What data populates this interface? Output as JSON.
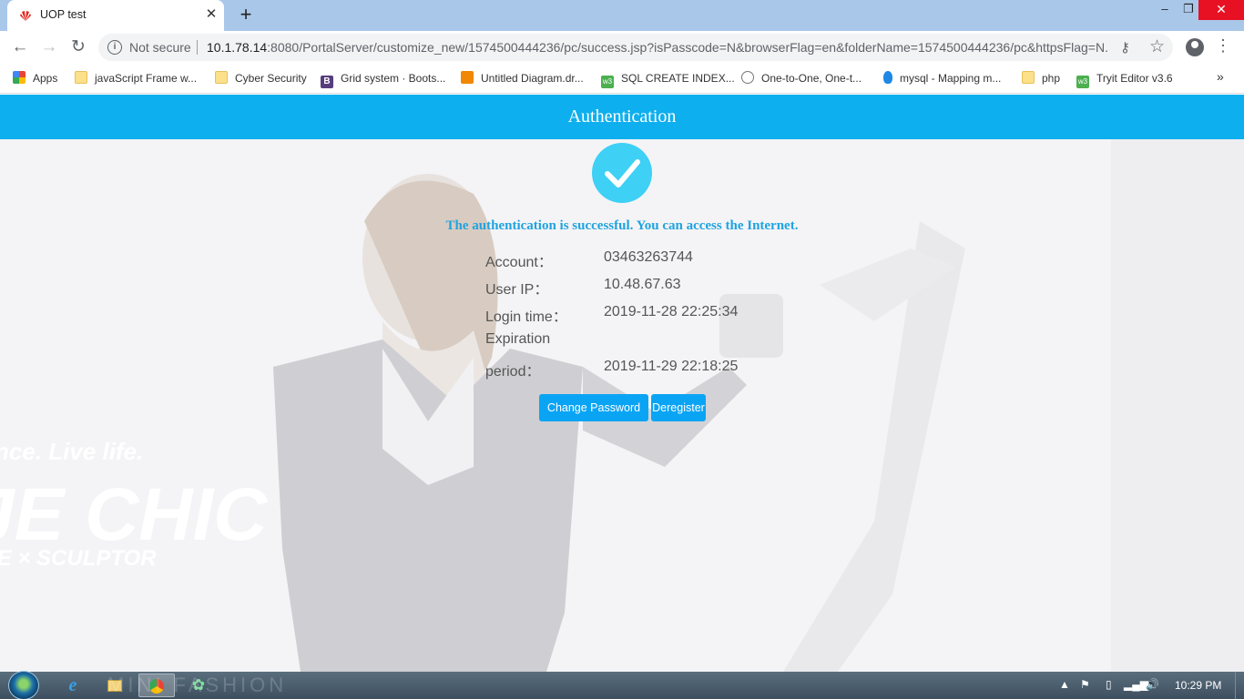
{
  "browser": {
    "tab": {
      "title": "UOP test"
    },
    "new_tab_label": "+",
    "window_controls": {
      "minimize": "–",
      "maximize": "❐",
      "close": "✕"
    },
    "toolbar": {
      "back": "←",
      "forward": "→",
      "reload": "↻",
      "security_label": "Not secure",
      "url_host": "10.1.78.14",
      "url_rest": ":8080/PortalServer/customize_new/1574500444236/pc/success.jsp?isPasscode=N&browserFlag=en&folderName=1574500444236/pc&httpsFlag=N..."
    },
    "bookmarks": [
      {
        "label": "Apps",
        "icon": "apps-grid-icon"
      },
      {
        "label": "javaScript Frame w...",
        "icon": "folder-icon"
      },
      {
        "label": "Cyber Security",
        "icon": "folder-icon"
      },
      {
        "label": "Grid system · Boots...",
        "icon": "bootstrap-icon"
      },
      {
        "label": "Untitled Diagram.dr...",
        "icon": "drawio-icon"
      },
      {
        "label": "SQL CREATE INDEX...",
        "icon": "w3schools-icon"
      },
      {
        "label": "One-to-One, One-t...",
        "icon": "site-icon"
      },
      {
        "label": "mysql - Mapping m...",
        "icon": "mysql-icon"
      },
      {
        "label": "php",
        "icon": "folder-icon"
      },
      {
        "label": "Tryit Editor v3.6",
        "icon": "w3schools-icon"
      }
    ],
    "bookmarks_more": "»"
  },
  "page": {
    "header_title": "Authentication",
    "success_message": "The authentication is successful. You can access the Internet.",
    "fields": {
      "account_label": "Account：",
      "account_value": "03463263744",
      "ip_label": "User IP：",
      "ip_value": "10.48.67.63",
      "login_label": "Login time：",
      "login_value": "2019-11-28 22:25:34",
      "expiration_label_1": "Expiration",
      "expiration_label_2": "period：",
      "expiration_value": "2019-11-29 22:18:25"
    },
    "buttons": {
      "change_password": "Change Password",
      "deregister": "Deregister"
    },
    "background_text": {
      "tagline": "nce. Live life.",
      "brand": "JE CHIC",
      "sub": "IE × SCULPTOR",
      "fashion": "MINI FASHION"
    }
  },
  "taskbar": {
    "clock": "10:29 PM"
  },
  "colors": {
    "header": "#0eafee",
    "accent_text": "#20a3e0",
    "button": "#0aa4f5",
    "check_circle": "#3ed0f5"
  }
}
